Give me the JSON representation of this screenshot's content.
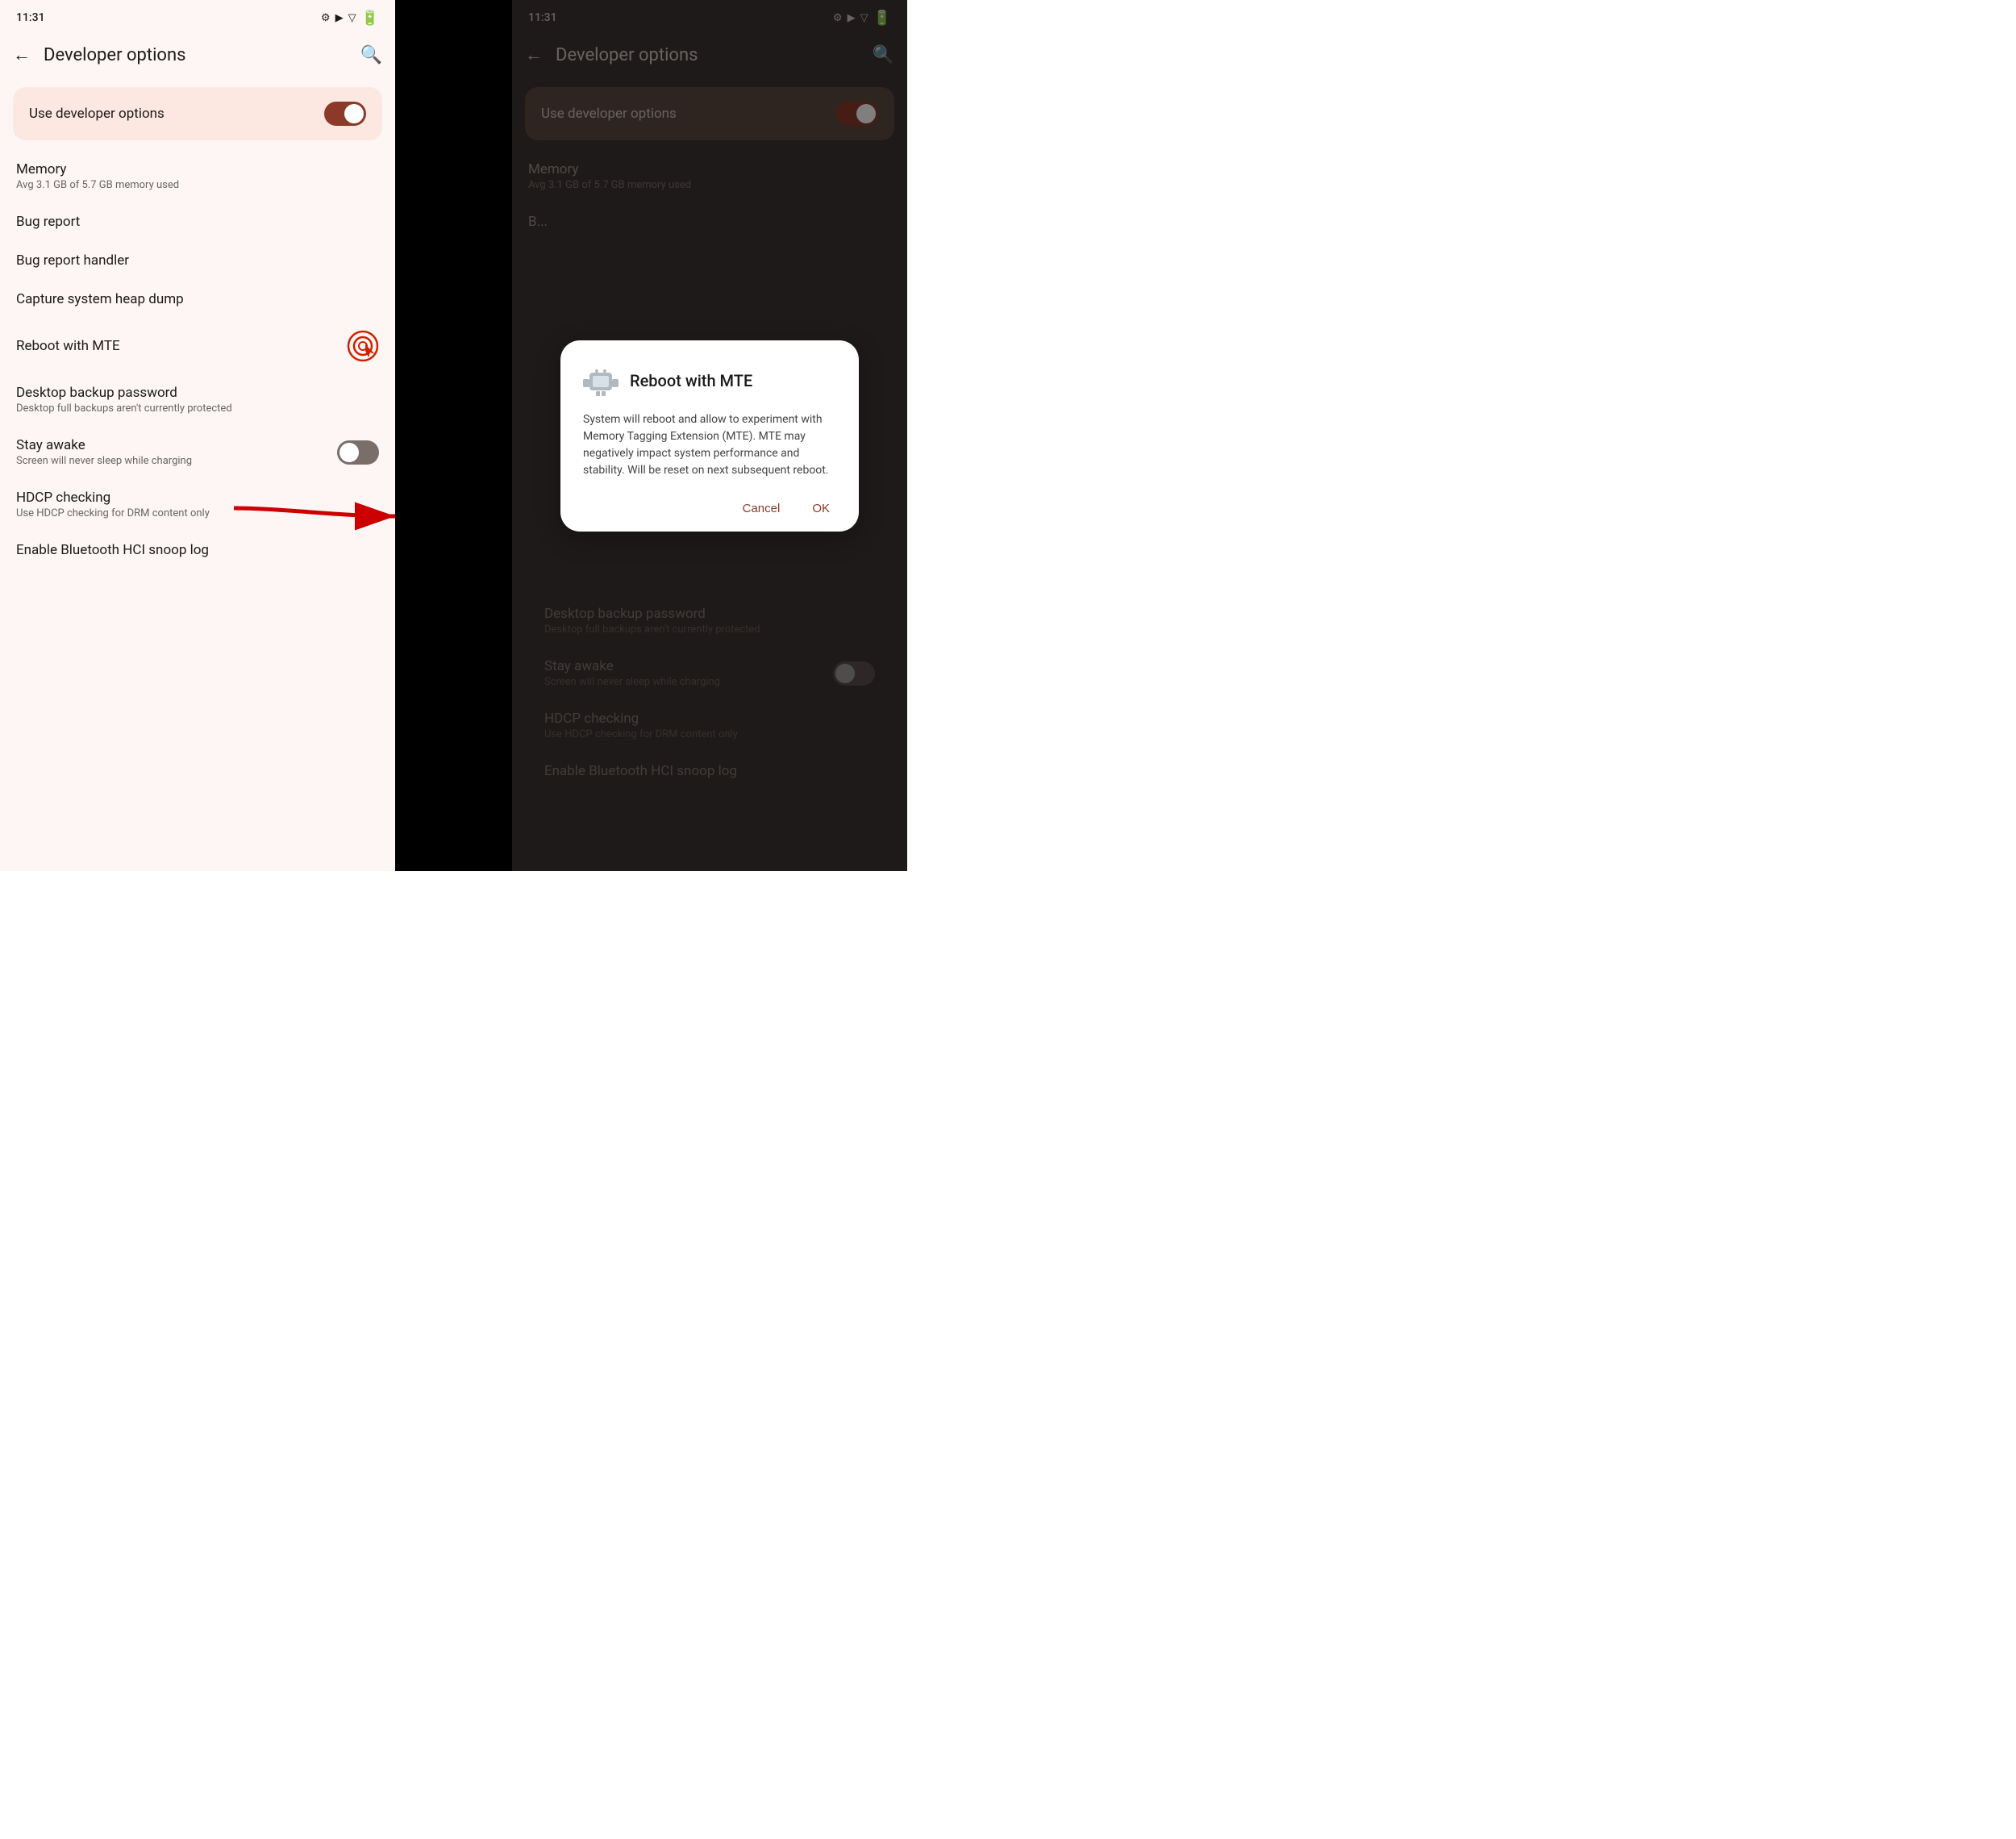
{
  "left": {
    "statusBar": {
      "time": "11:31",
      "icons": [
        "⚙",
        "▶",
        "▽"
      ]
    },
    "nav": {
      "back": "←",
      "title": "Developer options",
      "search": "🔍"
    },
    "devOptionsCard": {
      "label": "Use developer options",
      "toggleState": "on"
    },
    "items": [
      {
        "title": "Memory",
        "subtitle": "Avg 3.1 GB of 5.7 GB memory used",
        "hasToggle": false
      },
      {
        "title": "Bug report",
        "subtitle": "",
        "hasToggle": false
      },
      {
        "title": "Bug report handler",
        "subtitle": "",
        "hasToggle": false
      },
      {
        "title": "Capture system heap dump",
        "subtitle": "",
        "hasToggle": false
      },
      {
        "title": "Reboot with MTE",
        "subtitle": "",
        "hasToggle": false,
        "hasClickIcon": true
      },
      {
        "title": "Desktop backup password",
        "subtitle": "Desktop full backups aren't currently protected",
        "hasToggle": false
      },
      {
        "title": "Stay awake",
        "subtitle": "Screen will never sleep while charging",
        "hasToggle": true,
        "toggleState": "off"
      },
      {
        "title": "HDCP checking",
        "subtitle": "Use HDCP checking for DRM content only",
        "hasToggle": false
      },
      {
        "title": "Enable Bluetooth HCI snoop log",
        "subtitle": "",
        "hasToggle": false
      }
    ]
  },
  "right": {
    "statusBar": {
      "time": "11:31",
      "icons": [
        "⚙",
        "▶",
        "▽"
      ]
    },
    "nav": {
      "back": "←",
      "title": "Developer options",
      "search": "🔍"
    },
    "devOptionsCard": {
      "label": "Use developer options",
      "toggleState": "on"
    },
    "items": [
      {
        "title": "Memory",
        "subtitle": "Avg 3.1 GB of 5.7 GB memory used",
        "hasToggle": false
      },
      {
        "title": "Bug report",
        "subtitle": "",
        "hasToggle": false
      },
      {
        "title": "Desktop backup password",
        "subtitle": "Desktop full backups aren't currently protected",
        "hasToggle": false
      },
      {
        "title": "Stay awake",
        "subtitle": "Screen will never sleep while charging",
        "hasToggle": true,
        "toggleState": "off"
      },
      {
        "title": "HDCP checking",
        "subtitle": "Use HDCP checking for DRM content only",
        "hasToggle": false
      },
      {
        "title": "Enable Bluetooth HCI snoop log",
        "subtitle": "",
        "hasToggle": false
      }
    ],
    "dialog": {
      "title": "Reboot with MTE",
      "body": "System will reboot and allow to experiment with Memory Tagging Extension (MTE). MTE may negatively impact system performance and stability. Will be reset on next subsequent reboot.",
      "cancelLabel": "Cancel",
      "okLabel": "OK"
    }
  }
}
